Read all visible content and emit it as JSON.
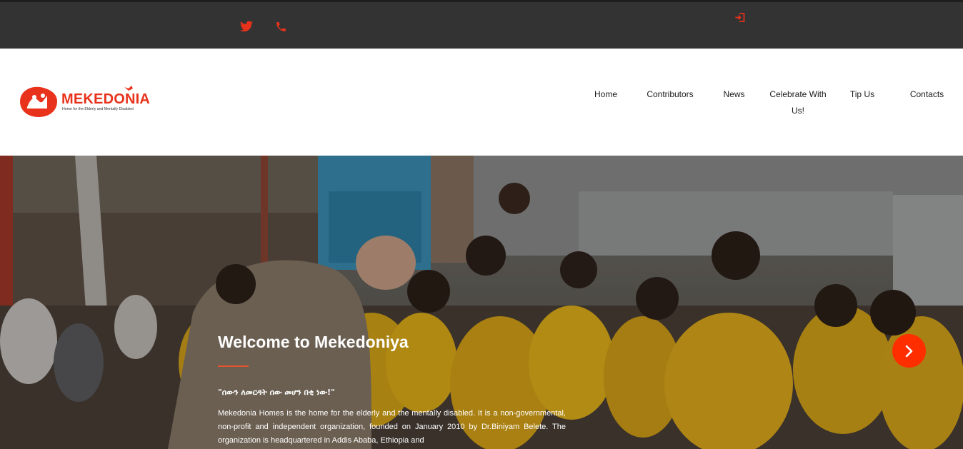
{
  "topbar": {
    "icons": [
      "twitter-icon",
      "phone-icon",
      "login-icon"
    ],
    "icon_color": "#e8321c"
  },
  "brand": {
    "name": "MEKEDONIA",
    "tagline": "Home for the Elderly and Mentally Disabled",
    "color": "#e8321c"
  },
  "nav": {
    "items": [
      {
        "label": "Home"
      },
      {
        "label": "Contributors"
      },
      {
        "label": "News"
      },
      {
        "label": "Celebrate With Us!"
      },
      {
        "label": "Tip Us"
      },
      {
        "label": "Contacts"
      }
    ]
  },
  "hero": {
    "title": "Welcome to Mekedoniya",
    "quote": "\"ሰውን ለመርዳት ሰው መሆን በቂ ነው!\"",
    "description": "Mekedonia Homes is the home for the elderly and the mentally disabled. It is a non-governmental, non-profit and independent organization, founded on January 2010 by Dr.Biniyam Belete. The organization is headquartered in Addis Ababa, Ethiopia and",
    "next_icon": "chevron-right-icon",
    "accent": "#ff2e00"
  }
}
